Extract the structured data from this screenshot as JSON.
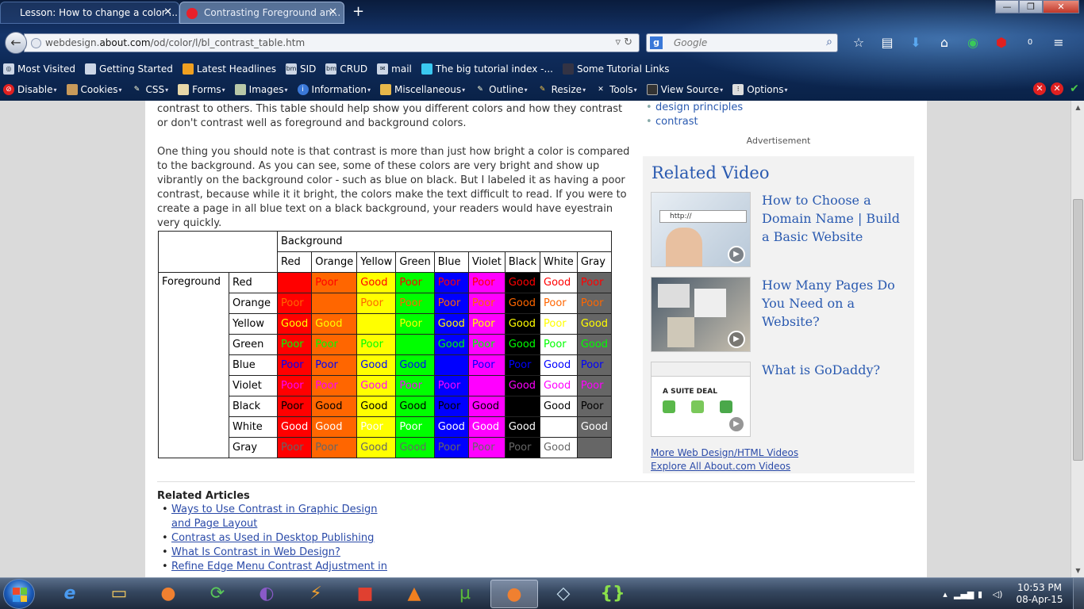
{
  "browser": {
    "tabs": [
      {
        "label": "Lesson: How to change a color ..."
      },
      {
        "label": "Contrasting Foreground an..."
      }
    ],
    "new_tab": "+",
    "window_buttons": {
      "minimize": "—",
      "maximize": "❐",
      "close": "✕"
    },
    "url_domain": "webdesign.about.com",
    "url_prefix": "webdesign.",
    "url_host": "about.com",
    "url_path": "/od/color/l/bl_contrast_table.htm",
    "search_placeholder": "Google",
    "bookmarks": [
      "Most Visited",
      "Getting Started",
      "Latest Headlines",
      "SID",
      "CRUD",
      "mail",
      "The big tutorial index -...",
      "Some Tutorial Links"
    ],
    "devtools": [
      "Disable",
      "Cookies",
      "CSS",
      "Forms",
      "Images",
      "Information",
      "Miscellaneous",
      "Outline",
      "Resize",
      "Tools",
      "View Source",
      "Options"
    ]
  },
  "article": {
    "para1": "contrast to others. This table should help show you different colors and how they contrast or don't contrast well as foreground and background colors.",
    "para2": "One thing you should note is that contrast is more than just how bright a color is compared to the background. As you can see, some of these colors are very bright and show up vibrantly on the background color - such as blue on black. But I labeled it as having a poor contrast, because while it it bright, the colors make the text difficult to read. If you were to create a page in all blue text on a black background, your readers would have eyestrain very quickly."
  },
  "table": {
    "background_label": "Background",
    "foreground_label": "Foreground",
    "colors": [
      {
        "name": "Red",
        "hex": "#ff0000"
      },
      {
        "name": "Orange",
        "hex": "#ff6600"
      },
      {
        "name": "Yellow",
        "hex": "#ffff00"
      },
      {
        "name": "Green",
        "hex": "#00ff00"
      },
      {
        "name": "Blue",
        "hex": "#0000ff"
      },
      {
        "name": "Violet",
        "hex": "#ff00ff"
      },
      {
        "name": "Black",
        "hex": "#000000"
      },
      {
        "name": "White",
        "hex": "#ffffff"
      },
      {
        "name": "Gray",
        "hex": "#666666"
      }
    ],
    "ratings": [
      [
        "",
        "Poor",
        "Good",
        "Poor",
        "Poor",
        "Poor",
        "Good",
        "Good",
        "Poor"
      ],
      [
        "Poor",
        "",
        "Poor",
        "Poor",
        "Poor",
        "Poor",
        "Good",
        "Poor",
        "Poor"
      ],
      [
        "Good",
        "Good",
        "",
        "Poor",
        "Good",
        "Poor",
        "Good",
        "Poor",
        "Good"
      ],
      [
        "Poor",
        "Poor",
        "Poor",
        "",
        "Good",
        "Poor",
        "Good",
        "Poor",
        "Good"
      ],
      [
        "Poor",
        "Poor",
        "Good",
        "Good",
        "",
        "Poor",
        "Poor",
        "Good",
        "Poor"
      ],
      [
        "Poor",
        "Poor",
        "Good",
        "Poor",
        "Poor",
        "",
        "Good",
        "Good",
        "Poor"
      ],
      [
        "Poor",
        "Good",
        "Good",
        "Good",
        "Poor",
        "Good",
        "",
        "Good",
        "Poor"
      ],
      [
        "Good",
        "Good",
        "Poor",
        "Poor",
        "Good",
        "Good",
        "Good",
        "",
        "Good"
      ],
      [
        "Poor",
        "Poor",
        "Good",
        "Good",
        "Poor",
        "Poor",
        "Poor",
        "Good",
        ""
      ]
    ]
  },
  "sidebar": {
    "links": [
      "design principles",
      "contrast"
    ],
    "advertisement": "Advertisement",
    "related_video_title": "Related Video",
    "videos": [
      {
        "title": "How to Choose a Domain Name | Build a Basic Website"
      },
      {
        "title": "How Many Pages Do You Need on a Website?"
      },
      {
        "title": "What is GoDaddy?"
      }
    ],
    "thumb_text_1": "http://",
    "thumb_text_3": "A SUITE DEAL",
    "more_videos": "More Web Design/HTML Videos",
    "explore_videos": "Explore All About.com Videos"
  },
  "related_articles": {
    "heading": "Related Articles",
    "items": [
      "Ways to Use Contrast in Graphic Design and Page Layout",
      "Contrast as Used in Desktop Publishing",
      "What Is Contrast in Web Design?",
      "Refine Edge Menu Contrast Adjustment in"
    ]
  },
  "taskbar": {
    "time": "10:53 PM",
    "date": "08-Apr-15"
  }
}
